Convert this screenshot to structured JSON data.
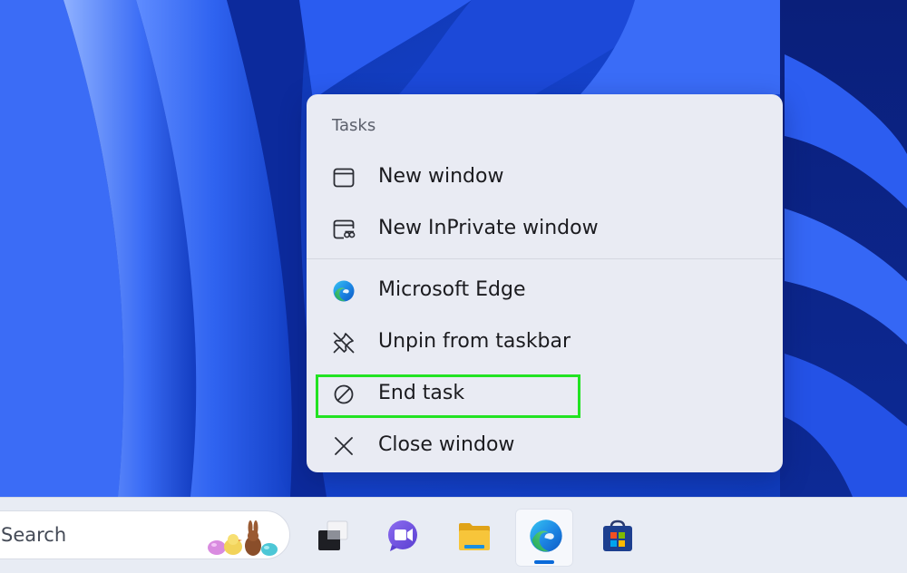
{
  "jumplist": {
    "header": "Tasks",
    "items": [
      {
        "label": "New window",
        "icon": "window-icon"
      },
      {
        "label": "New InPrivate window",
        "icon": "inprivate-window-icon"
      },
      {
        "label": "Microsoft Edge",
        "icon": "edge-logo-icon"
      },
      {
        "label": "Unpin from taskbar",
        "icon": "unpin-icon"
      },
      {
        "label": "End task",
        "icon": "end-task-icon"
      },
      {
        "label": "Close window",
        "icon": "close-icon"
      }
    ]
  },
  "taskbar": {
    "search_label": "Search",
    "apps": [
      {
        "name": "Task View",
        "icon": "task-view-icon"
      },
      {
        "name": "Clipchamp",
        "icon": "video-chat-icon"
      },
      {
        "name": "File Explorer",
        "icon": "folder-icon"
      },
      {
        "name": "Microsoft Edge",
        "icon": "edge-logo-icon",
        "active": true
      },
      {
        "name": "Microsoft Store",
        "icon": "store-icon"
      }
    ]
  },
  "colors": {
    "highlight": "#22e322",
    "menu_background": "#e9ebf3",
    "wallpaper_blue": "#1a4fd8",
    "taskbar_background": "#e8ecf4",
    "edge_indicator": "#0a6ad9"
  }
}
